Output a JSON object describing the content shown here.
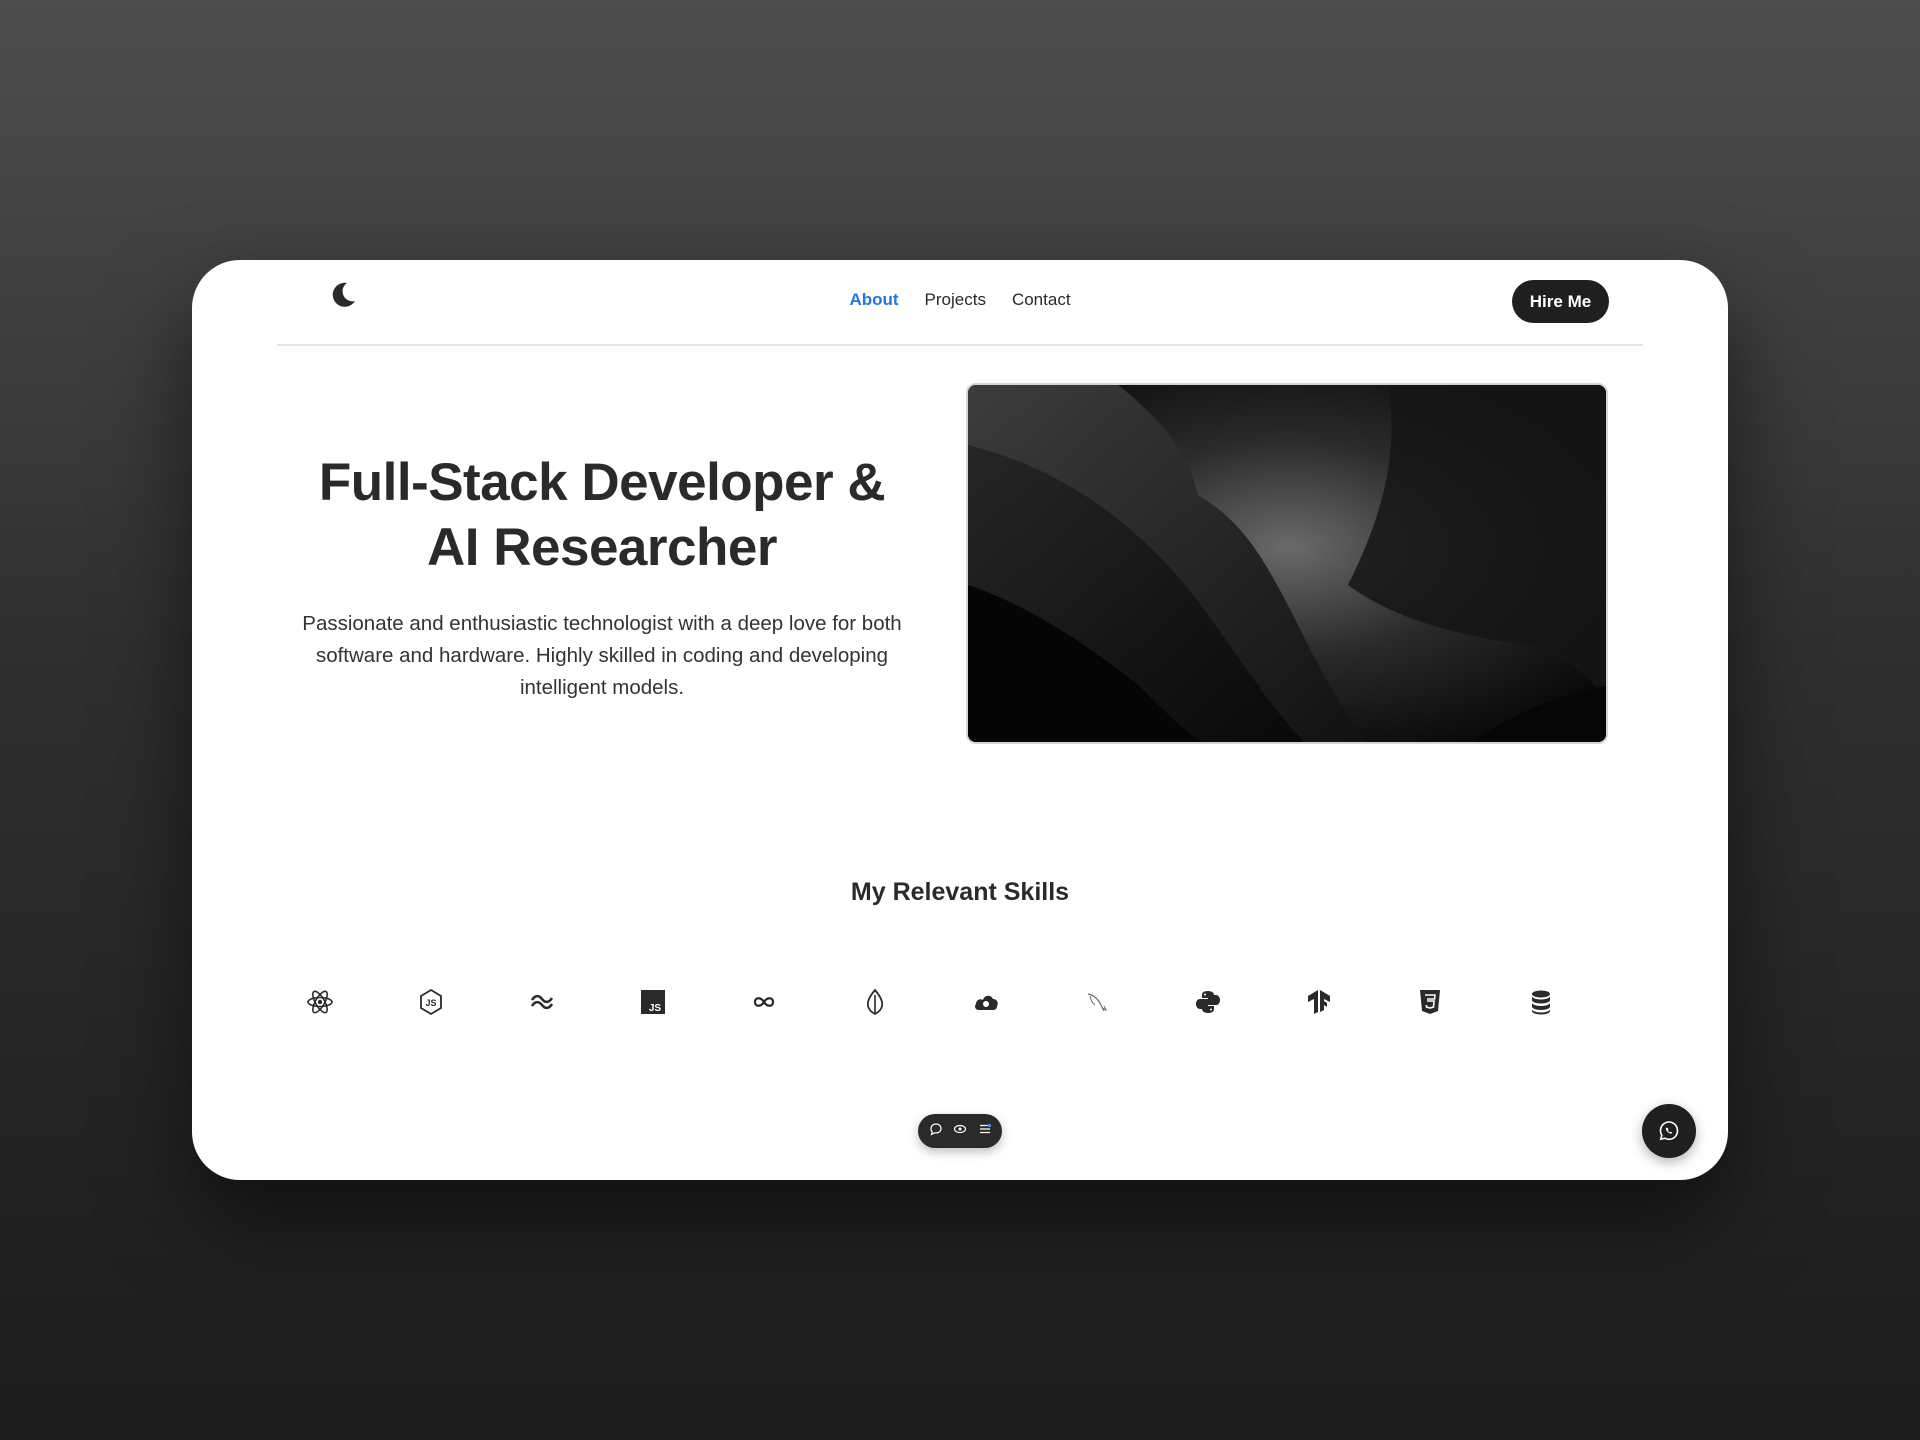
{
  "nav": {
    "logo_icon": "moon-icon",
    "links": [
      {
        "label": "About",
        "active": true
      },
      {
        "label": "Projects",
        "active": false
      },
      {
        "label": "Contact",
        "active": false
      }
    ],
    "hire_label": "Hire Me"
  },
  "hero": {
    "title_line1": "Full-Stack Developer &",
    "title_line2": "AI Researcher",
    "subtitle": "Passionate and enthusiastic technologist with a deep love for both software and hardware. Highly skilled in coding and developing intelligent models."
  },
  "skills": {
    "title": "My Relevant Skills",
    "icons": [
      "react-icon",
      "nodejs-icon",
      "tailwind-icon",
      "javascript-icon",
      "infinity-icon",
      "mongodb-icon",
      "cloud-icon",
      "mysql-icon",
      "python-icon",
      "tensorflow-icon",
      "css3-icon",
      "database-icon"
    ]
  },
  "dock": {
    "icons": [
      "chat-bubble-icon",
      "eye-icon",
      "list-settings-icon"
    ]
  },
  "fab": {
    "icon": "whatsapp-icon"
  },
  "colors": {
    "accent": "#2176e0",
    "dark": "#1f1f1f",
    "text": "#2a2a2a"
  }
}
